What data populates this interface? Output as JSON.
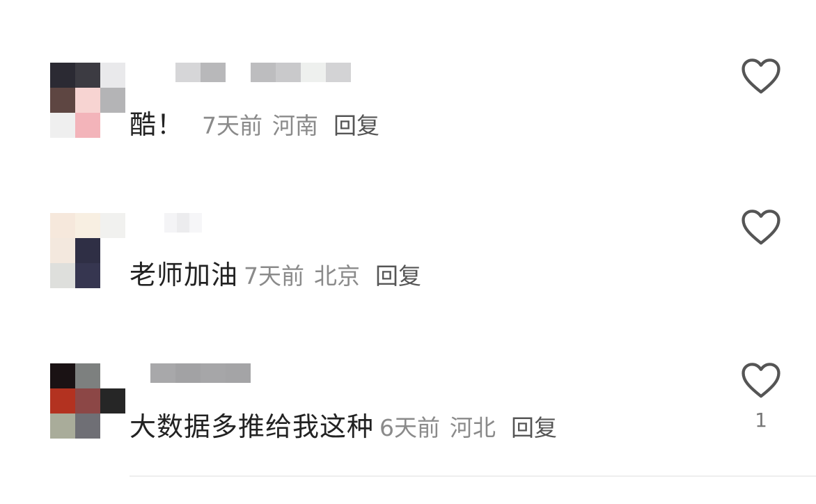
{
  "comments": [
    {
      "text": "酷！",
      "time": "7天前",
      "location": "河南",
      "reply_label": "回复",
      "like_count": "",
      "avatar_pixels": [
        "#2b2a33",
        "#3c3b42",
        "#e9e9eb",
        "#5e4642",
        "#f7d4d2",
        "#b4b4b6",
        "#efefef",
        "#f3b4ba",
        "#ffffff"
      ],
      "username_pixels": [
        "#d6d6d8",
        "#b8b8ba",
        "#ffffff",
        "#bdbdbf",
        "#c9c9cb",
        "#eef0ee",
        "#d3d3d5"
      ]
    },
    {
      "text": "老师加油",
      "time": "7天前",
      "location": "北京",
      "reply_label": "回复",
      "like_count": "",
      "avatar_pixels": [
        "#f6e8dc",
        "#f8efe2",
        "#f1f1ef",
        "#f3e8de",
        "#2f2f45",
        "#ffffff",
        "#dedfdc",
        "#363650",
        "#ffffff"
      ],
      "username_pixels": [
        "#f4f4f6",
        "#ececee",
        "#f6f6f8"
      ]
    },
    {
      "text": "大数据多推给我这种",
      "time": "6天前",
      "location": "河北",
      "reply_label": "回复",
      "like_count": "1",
      "avatar_pixels": [
        "#1a1214",
        "#7d807f",
        "#ffffff",
        "#b33220",
        "#8c4746",
        "#262626",
        "#a9ac9a",
        "#6f6f75",
        "#ffffff"
      ],
      "username_pixels": [
        "#a8a8aa",
        "#a2a2a4",
        "#a6a6a8",
        "#a4a4a6"
      ]
    }
  ],
  "colors": {
    "comment_text": "#222222",
    "meta_text": "#8a8a8a",
    "reply_text": "#555555",
    "like_icon": "#555555",
    "divider": "#eeeeee"
  },
  "icons": {
    "like": "heart-outline-icon"
  }
}
